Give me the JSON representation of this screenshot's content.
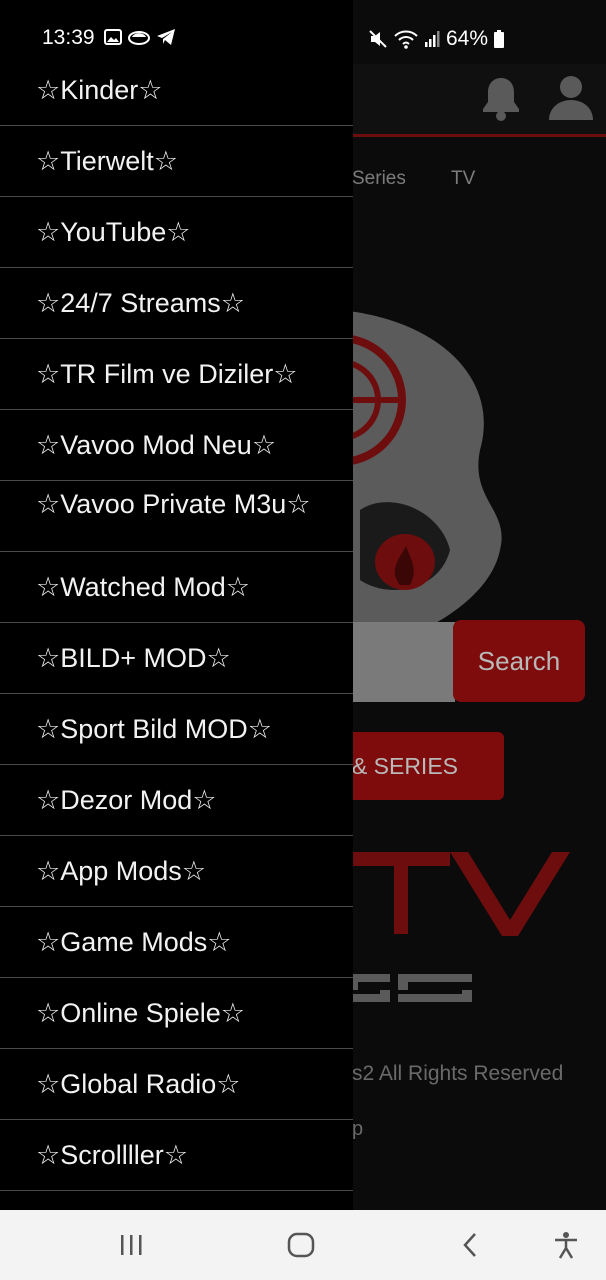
{
  "status_bar": {
    "time": "13:39",
    "battery": "64%",
    "icons_left": [
      "image-icon",
      "cloud-icon",
      "telegram-icon"
    ],
    "icons_right": [
      "mute-icon",
      "wifi-icon",
      "signal-icon",
      "battery-icon"
    ]
  },
  "background_app": {
    "tabs": [
      "Series",
      "TV"
    ],
    "search_button": "Search",
    "series_button": "S & SERIES",
    "logo_partial": "TV",
    "logo_sub_partial": "as2",
    "footer_rights": "s2 All Rights Reserved",
    "footer_link": "p",
    "colors": {
      "accent": "#7e0c0c",
      "bar_border": "#6e0d0d"
    }
  },
  "drawer": {
    "items": [
      "☆Kinder☆",
      "☆Tierwelt☆",
      "☆YouTube☆",
      "☆24/7 Streams☆",
      "☆TR Film ve Diziler☆",
      "☆Vavoo Mod Neu☆",
      "☆Vavoo Private M3u☆",
      "☆Watched Mod☆",
      "☆BILD+ MOD☆",
      "☆Sport Bild MOD☆",
      "☆Dezor Mod☆",
      "☆App Mods☆",
      "☆Game Mods☆",
      "☆Online Spiele☆",
      "☆Global Radio☆",
      "☆Scrollller☆"
    ]
  },
  "navbar": {
    "buttons": [
      "recent-apps",
      "home",
      "back",
      "accessibility"
    ]
  }
}
